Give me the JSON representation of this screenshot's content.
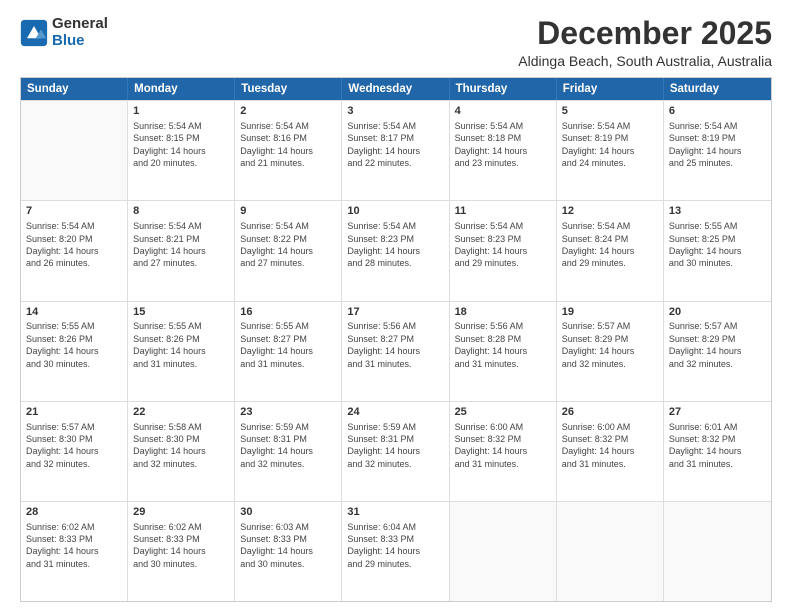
{
  "logo": {
    "general": "General",
    "blue": "Blue"
  },
  "title": "December 2025",
  "location": "Aldinga Beach, South Australia, Australia",
  "days_of_week": [
    "Sunday",
    "Monday",
    "Tuesday",
    "Wednesday",
    "Thursday",
    "Friday",
    "Saturday"
  ],
  "weeks": [
    [
      {
        "day": "",
        "empty": true
      },
      {
        "day": "1",
        "sunrise": "5:54 AM",
        "sunset": "8:15 PM",
        "daylight": "14 hours and 20 minutes."
      },
      {
        "day": "2",
        "sunrise": "5:54 AM",
        "sunset": "8:16 PM",
        "daylight": "14 hours and 21 minutes."
      },
      {
        "day": "3",
        "sunrise": "5:54 AM",
        "sunset": "8:17 PM",
        "daylight": "14 hours and 22 minutes."
      },
      {
        "day": "4",
        "sunrise": "5:54 AM",
        "sunset": "8:18 PM",
        "daylight": "14 hours and 23 minutes."
      },
      {
        "day": "5",
        "sunrise": "5:54 AM",
        "sunset": "8:19 PM",
        "daylight": "14 hours and 24 minutes."
      },
      {
        "day": "6",
        "sunrise": "5:54 AM",
        "sunset": "8:19 PM",
        "daylight": "14 hours and 25 minutes."
      }
    ],
    [
      {
        "day": "7",
        "sunrise": "5:54 AM",
        "sunset": "8:20 PM",
        "daylight": "14 hours and 26 minutes."
      },
      {
        "day": "8",
        "sunrise": "5:54 AM",
        "sunset": "8:21 PM",
        "daylight": "14 hours and 27 minutes."
      },
      {
        "day": "9",
        "sunrise": "5:54 AM",
        "sunset": "8:22 PM",
        "daylight": "14 hours and 27 minutes."
      },
      {
        "day": "10",
        "sunrise": "5:54 AM",
        "sunset": "8:23 PM",
        "daylight": "14 hours and 28 minutes."
      },
      {
        "day": "11",
        "sunrise": "5:54 AM",
        "sunset": "8:23 PM",
        "daylight": "14 hours and 29 minutes."
      },
      {
        "day": "12",
        "sunrise": "5:54 AM",
        "sunset": "8:24 PM",
        "daylight": "14 hours and 29 minutes."
      },
      {
        "day": "13",
        "sunrise": "5:55 AM",
        "sunset": "8:25 PM",
        "daylight": "14 hours and 30 minutes."
      }
    ],
    [
      {
        "day": "14",
        "sunrise": "5:55 AM",
        "sunset": "8:26 PM",
        "daylight": "14 hours and 30 minutes."
      },
      {
        "day": "15",
        "sunrise": "5:55 AM",
        "sunset": "8:26 PM",
        "daylight": "14 hours and 31 minutes."
      },
      {
        "day": "16",
        "sunrise": "5:55 AM",
        "sunset": "8:27 PM",
        "daylight": "14 hours and 31 minutes."
      },
      {
        "day": "17",
        "sunrise": "5:56 AM",
        "sunset": "8:27 PM",
        "daylight": "14 hours and 31 minutes."
      },
      {
        "day": "18",
        "sunrise": "5:56 AM",
        "sunset": "8:28 PM",
        "daylight": "14 hours and 31 minutes."
      },
      {
        "day": "19",
        "sunrise": "5:57 AM",
        "sunset": "8:29 PM",
        "daylight": "14 hours and 32 minutes."
      },
      {
        "day": "20",
        "sunrise": "5:57 AM",
        "sunset": "8:29 PM",
        "daylight": "14 hours and 32 minutes."
      }
    ],
    [
      {
        "day": "21",
        "sunrise": "5:57 AM",
        "sunset": "8:30 PM",
        "daylight": "14 hours and 32 minutes."
      },
      {
        "day": "22",
        "sunrise": "5:58 AM",
        "sunset": "8:30 PM",
        "daylight": "14 hours and 32 minutes."
      },
      {
        "day": "23",
        "sunrise": "5:59 AM",
        "sunset": "8:31 PM",
        "daylight": "14 hours and 32 minutes."
      },
      {
        "day": "24",
        "sunrise": "5:59 AM",
        "sunset": "8:31 PM",
        "daylight": "14 hours and 32 minutes."
      },
      {
        "day": "25",
        "sunrise": "6:00 AM",
        "sunset": "8:32 PM",
        "daylight": "14 hours and 31 minutes."
      },
      {
        "day": "26",
        "sunrise": "6:00 AM",
        "sunset": "8:32 PM",
        "daylight": "14 hours and 31 minutes."
      },
      {
        "day": "27",
        "sunrise": "6:01 AM",
        "sunset": "8:32 PM",
        "daylight": "14 hours and 31 minutes."
      }
    ],
    [
      {
        "day": "28",
        "sunrise": "6:02 AM",
        "sunset": "8:33 PM",
        "daylight": "14 hours and 31 minutes."
      },
      {
        "day": "29",
        "sunrise": "6:02 AM",
        "sunset": "8:33 PM",
        "daylight": "14 hours and 30 minutes."
      },
      {
        "day": "30",
        "sunrise": "6:03 AM",
        "sunset": "8:33 PM",
        "daylight": "14 hours and 30 minutes."
      },
      {
        "day": "31",
        "sunrise": "6:04 AM",
        "sunset": "8:33 PM",
        "daylight": "14 hours and 29 minutes."
      },
      {
        "day": "",
        "empty": true
      },
      {
        "day": "",
        "empty": true
      },
      {
        "day": "",
        "empty": true
      }
    ]
  ],
  "labels": {
    "sunrise": "Sunrise:",
    "sunset": "Sunset:",
    "daylight": "Daylight:"
  }
}
